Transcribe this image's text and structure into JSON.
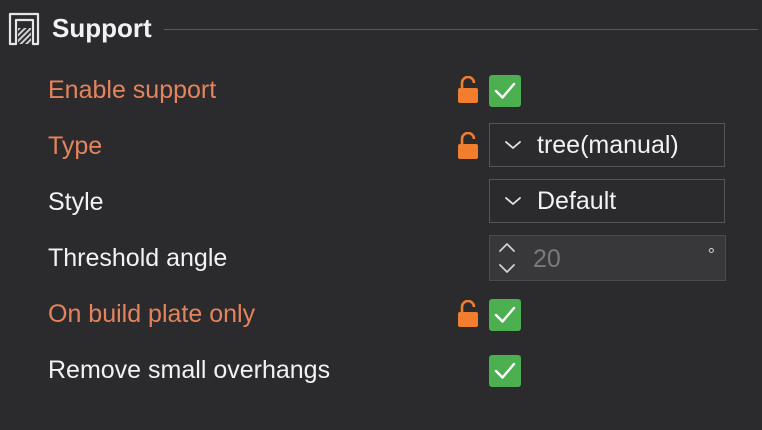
{
  "section": {
    "title": "Support",
    "icon": "support-section-icon"
  },
  "colors": {
    "modified": "#e5845c",
    "checkbox": "#4caf50",
    "background": "#2b2b2e"
  },
  "settings": {
    "enable_support": {
      "label": "Enable support",
      "modified": true,
      "checked": true,
      "lock_icon": "unlocked-padlock-icon"
    },
    "type": {
      "label": "Type",
      "modified": true,
      "value": "tree(manual)",
      "lock_icon": "unlocked-padlock-icon"
    },
    "style": {
      "label": "Style",
      "value": "Default"
    },
    "threshold_angle": {
      "label": "Threshold angle",
      "value": "20",
      "unit": "°"
    },
    "on_build_plate_only": {
      "label": "On build plate only",
      "modified": true,
      "checked": true,
      "lock_icon": "unlocked-padlock-icon"
    },
    "remove_small_overhangs": {
      "label": "Remove small overhangs",
      "checked": true
    }
  }
}
